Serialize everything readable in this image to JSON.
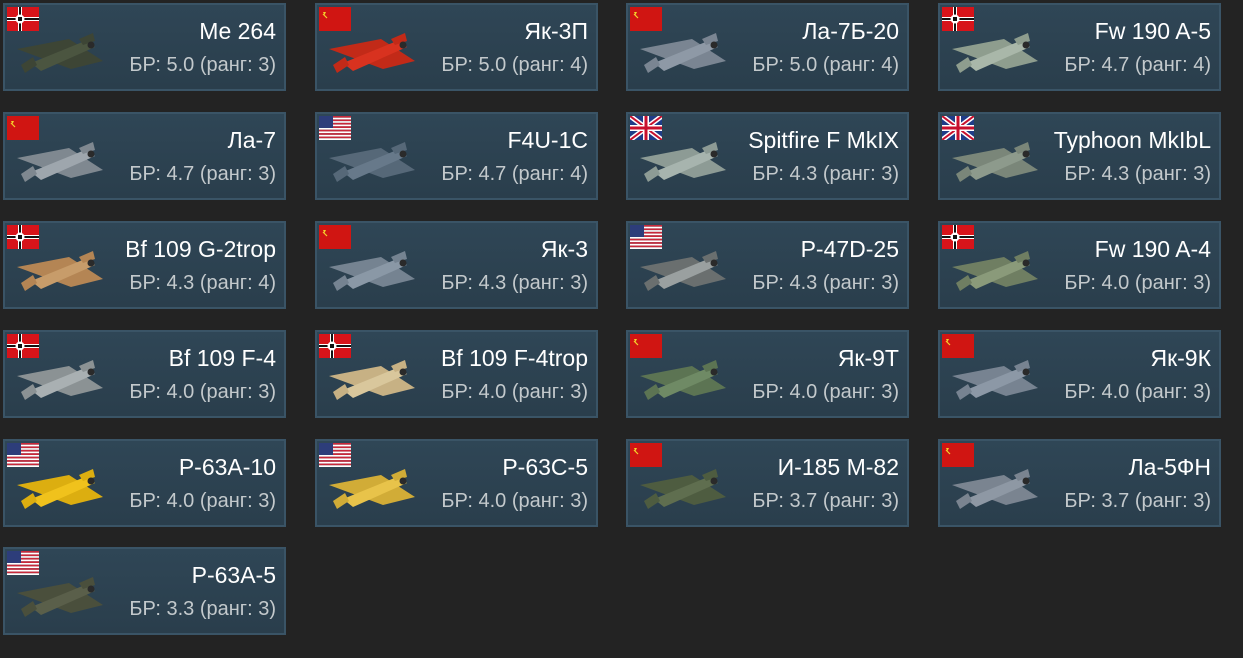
{
  "vehicles": [
    {
      "name": "Me 264",
      "br": "БР: 5.0 (ранг: 3)",
      "nation": "germany",
      "flag_icon": "german-flag-icon",
      "plane_icon": "me-264-plane-icon",
      "colors": {
        "body": "#4b5540",
        "wing": "#3d4535"
      }
    },
    {
      "name": "Як-3П",
      "br": "БР: 5.0 (ранг: 4)",
      "nation": "ussr",
      "flag_icon": "soviet-flag-icon",
      "plane_icon": "yak-3p-plane-icon",
      "colors": {
        "body": "#d8321f",
        "wing": "#c22a18"
      }
    },
    {
      "name": "Ла-7Б-20",
      "br": "БР: 5.0 (ранг: 4)",
      "nation": "ussr",
      "flag_icon": "soviet-flag-icon",
      "plane_icon": "la-7b-20-plane-icon",
      "colors": {
        "body": "#8e99a6",
        "wing": "#7a8592"
      }
    },
    {
      "name": "Fw 190 A-5",
      "br": "БР: 4.7 (ранг: 4)",
      "nation": "germany",
      "flag_icon": "german-flag-icon",
      "plane_icon": "fw-190-a5-plane-icon",
      "colors": {
        "body": "#a9b7a9",
        "wing": "#8e9d8e"
      }
    },
    {
      "name": "Ла-7",
      "br": "БР: 4.7 (ранг: 3)",
      "nation": "ussr",
      "flag_icon": "soviet-flag-icon",
      "plane_icon": "la-7-plane-icon",
      "colors": {
        "body": "#9ea6ad",
        "wing": "#7f8890"
      }
    },
    {
      "name": "F4U-1C",
      "br": "БР: 4.7 (ранг: 4)",
      "nation": "usa",
      "flag_icon": "us-flag-icon",
      "plane_icon": "f4u-1c-plane-icon",
      "colors": {
        "body": "#67798a",
        "wing": "#566878"
      }
    },
    {
      "name": "Spitfire F MkIX",
      "br": "БР: 4.3 (ранг: 3)",
      "nation": "uk",
      "flag_icon": "uk-flag-icon",
      "plane_icon": "spitfire-f-mkix-plane-icon",
      "colors": {
        "body": "#a7b4ae",
        "wing": "#8d9b95"
      }
    },
    {
      "name": "Typhoon MkIbL",
      "br": "БР: 4.3 (ранг: 3)",
      "nation": "uk",
      "flag_icon": "uk-flag-icon",
      "plane_icon": "typhoon-mkibl-plane-icon",
      "colors": {
        "body": "#8d9a8c",
        "wing": "#7a8679"
      }
    },
    {
      "name": "Bf 109 G-2trop",
      "br": "БР: 4.3 (ранг: 4)",
      "nation": "germany",
      "flag_icon": "german-flag-icon",
      "plane_icon": "bf-109-g2trop-plane-icon",
      "colors": {
        "body": "#c79c6a",
        "wing": "#b48554"
      }
    },
    {
      "name": "Як-3",
      "br": "БР: 4.3 (ранг: 3)",
      "nation": "ussr",
      "flag_icon": "soviet-flag-icon",
      "plane_icon": "yak-3-plane-icon",
      "colors": {
        "body": "#8a98a6",
        "wing": "#758391"
      }
    },
    {
      "name": "P-47D-25",
      "br": "БР: 4.3 (ранг: 3)",
      "nation": "usa",
      "flag_icon": "us-flag-icon",
      "plane_icon": "p-47d-25-plane-icon",
      "colors": {
        "body": "#9aa0a0",
        "wing": "#6a6f6f"
      }
    },
    {
      "name": "Fw 190 A-4",
      "br": "БР: 4.0 (ранг: 3)",
      "nation": "germany",
      "flag_icon": "german-flag-icon",
      "plane_icon": "fw-190-a4-plane-icon",
      "colors": {
        "body": "#8a9a7a",
        "wing": "#6f7e62"
      }
    },
    {
      "name": "Bf 109 F-4",
      "br": "БР: 4.0 (ранг: 3)",
      "nation": "germany",
      "flag_icon": "german-flag-icon",
      "plane_icon": "bf-109-f4-plane-icon",
      "colors": {
        "body": "#a9b0b2",
        "wing": "#8b9294"
      }
    },
    {
      "name": "Bf 109 F-4trop",
      "br": "БР: 4.0 (ранг: 3)",
      "nation": "germany",
      "flag_icon": "german-flag-icon",
      "plane_icon": "bf-109-f4trop-plane-icon",
      "colors": {
        "body": "#d9c79c",
        "wing": "#c7b184"
      }
    },
    {
      "name": "Як-9Т",
      "br": "БР: 4.0 (ранг: 3)",
      "nation": "ussr",
      "flag_icon": "soviet-flag-icon",
      "plane_icon": "yak-9t-plane-icon",
      "colors": {
        "body": "#6f8a65",
        "wing": "#5c7453"
      }
    },
    {
      "name": "Як-9К",
      "br": "БР: 4.0 (ранг: 3)",
      "nation": "ussr",
      "flag_icon": "soviet-flag-icon",
      "plane_icon": "yak-9k-plane-icon",
      "colors": {
        "body": "#8c98a6",
        "wing": "#778391"
      }
    },
    {
      "name": "P-63A-10",
      "br": "БР: 4.0 (ранг: 3)",
      "nation": "usa",
      "flag_icon": "us-flag-icon",
      "plane_icon": "p-63a-10-plane-icon",
      "colors": {
        "body": "#f0c21c",
        "wing": "#dcae10"
      }
    },
    {
      "name": "P-63C-5",
      "br": "БР: 4.0 (ранг: 3)",
      "nation": "usa",
      "flag_icon": "us-flag-icon",
      "plane_icon": "p-63c-5-plane-icon",
      "colors": {
        "body": "#e8c34a",
        "wing": "#d1ac37"
      }
    },
    {
      "name": "И-185 М-82",
      "br": "БР: 3.7 (ранг: 3)",
      "nation": "ussr",
      "flag_icon": "soviet-flag-icon",
      "plane_icon": "i-185-m82-plane-icon",
      "colors": {
        "body": "#5f6e4f",
        "wing": "#4e5c40"
      }
    },
    {
      "name": "Ла-5ФН",
      "br": "БР: 3.7 (ранг: 3)",
      "nation": "ussr",
      "flag_icon": "soviet-flag-icon",
      "plane_icon": "la-5fn-plane-icon",
      "colors": {
        "body": "#8e98a4",
        "wing": "#7a8490"
      }
    },
    {
      "name": "P-63A-5",
      "br": "БР: 3.3 (ранг: 3)",
      "nation": "usa",
      "flag_icon": "us-flag-icon",
      "plane_icon": "p-63a-5-plane-icon",
      "colors": {
        "body": "#5a5f4a",
        "wing": "#4a4f3c"
      }
    }
  ]
}
